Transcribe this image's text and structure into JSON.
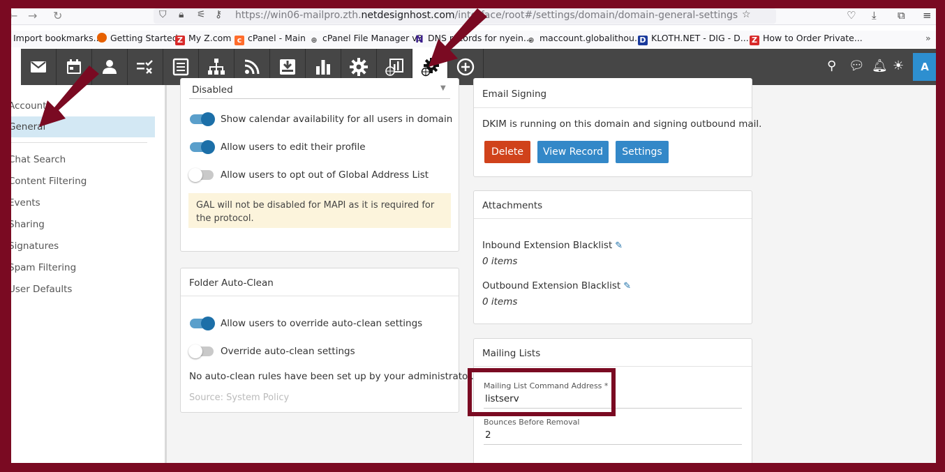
{
  "browser": {
    "url_prefix": "https://win06-mailpro.zth.",
    "url_domain": "netdesignhost.com",
    "url_suffix": "/interface/root#/settings/domain/domain-general-settings",
    "bookmarks": [
      {
        "label": "Import bookmarks...",
        "icon": "import-icon",
        "color": "#888888"
      },
      {
        "label": "Getting Started",
        "icon": "firefox-icon",
        "color": "#e66000"
      },
      {
        "label": "My Z.com",
        "icon": "z-icon",
        "color": "#d82a2a"
      },
      {
        "label": "cPanel - Main",
        "icon": "cpanel-icon",
        "color": "#ff6c2c"
      },
      {
        "label": "cPanel File Manager v3",
        "icon": "globe-icon",
        "color": "#555555"
      },
      {
        "label": "DNS records for nyein...",
        "icon": "n-icon",
        "color": "#3b1e8c"
      },
      {
        "label": "maccount.globalithou...",
        "icon": "globe-icon",
        "color": "#555555"
      },
      {
        "label": "KLOTH.NET - DIG - D...",
        "icon": "kloth-icon",
        "color": "#1a3a9c"
      },
      {
        "label": "How to Order Private...",
        "icon": "z-icon",
        "color": "#d82a2a"
      }
    ]
  },
  "toolbar": {
    "items": [
      "mail-icon",
      "calendar-icon",
      "contacts-icon",
      "tasks-icon",
      "notes-icon",
      "network-icon",
      "rss-icon",
      "archive-icon",
      "reports-icon",
      "settings-icon",
      "domain-reports-icon",
      "domain-settings-icon",
      "add-icon"
    ],
    "avatar": "A"
  },
  "sidebar": {
    "items": [
      "Accounts",
      "General",
      "Chat Search",
      "Content Filtering",
      "Events",
      "Sharing",
      "Signatures",
      "Spam Filtering",
      "User Defaults"
    ],
    "selected": "General"
  },
  "left_card": {
    "dropdown_value": "Disabled",
    "toggles": [
      {
        "label": "Show calendar availability for all users in domain",
        "on": true
      },
      {
        "label": "Allow users to edit their profile",
        "on": true
      },
      {
        "label": "Allow users to opt out of Global Address List",
        "on": false
      }
    ],
    "notice": "GAL will not be disabled for MAPI as it is required for the protocol."
  },
  "folder_card": {
    "title": "Folder Auto-Clean",
    "toggles": [
      {
        "label": "Allow users to override auto-clean settings",
        "on": true
      },
      {
        "label": "Override auto-clean settings",
        "on": false
      }
    ],
    "message": "No auto-clean rules have been set up by your administrator.",
    "source": "Source: System Policy"
  },
  "email_signing": {
    "title": "Email Signing",
    "status": "DKIM is running on this domain and signing outbound mail.",
    "delete_label": "Delete",
    "view_label": "View Record",
    "settings_label": "Settings"
  },
  "attachments": {
    "title": "Attachments",
    "inbound_label": "Inbound Extension Blacklist",
    "inbound_count": "0 items",
    "outbound_label": "Outbound Extension Blacklist",
    "outbound_count": "0 items"
  },
  "mailing_lists": {
    "title": "Mailing Lists",
    "command_label": "Mailing List Command Address *",
    "command_value": "listserv",
    "bounces_label": "Bounces Before Removal",
    "bounces_value": "2"
  },
  "colors": {
    "annotation": "#7a0a22",
    "accent": "#1c6fa8",
    "delete": "#d0421b",
    "button": "#3388c8"
  }
}
